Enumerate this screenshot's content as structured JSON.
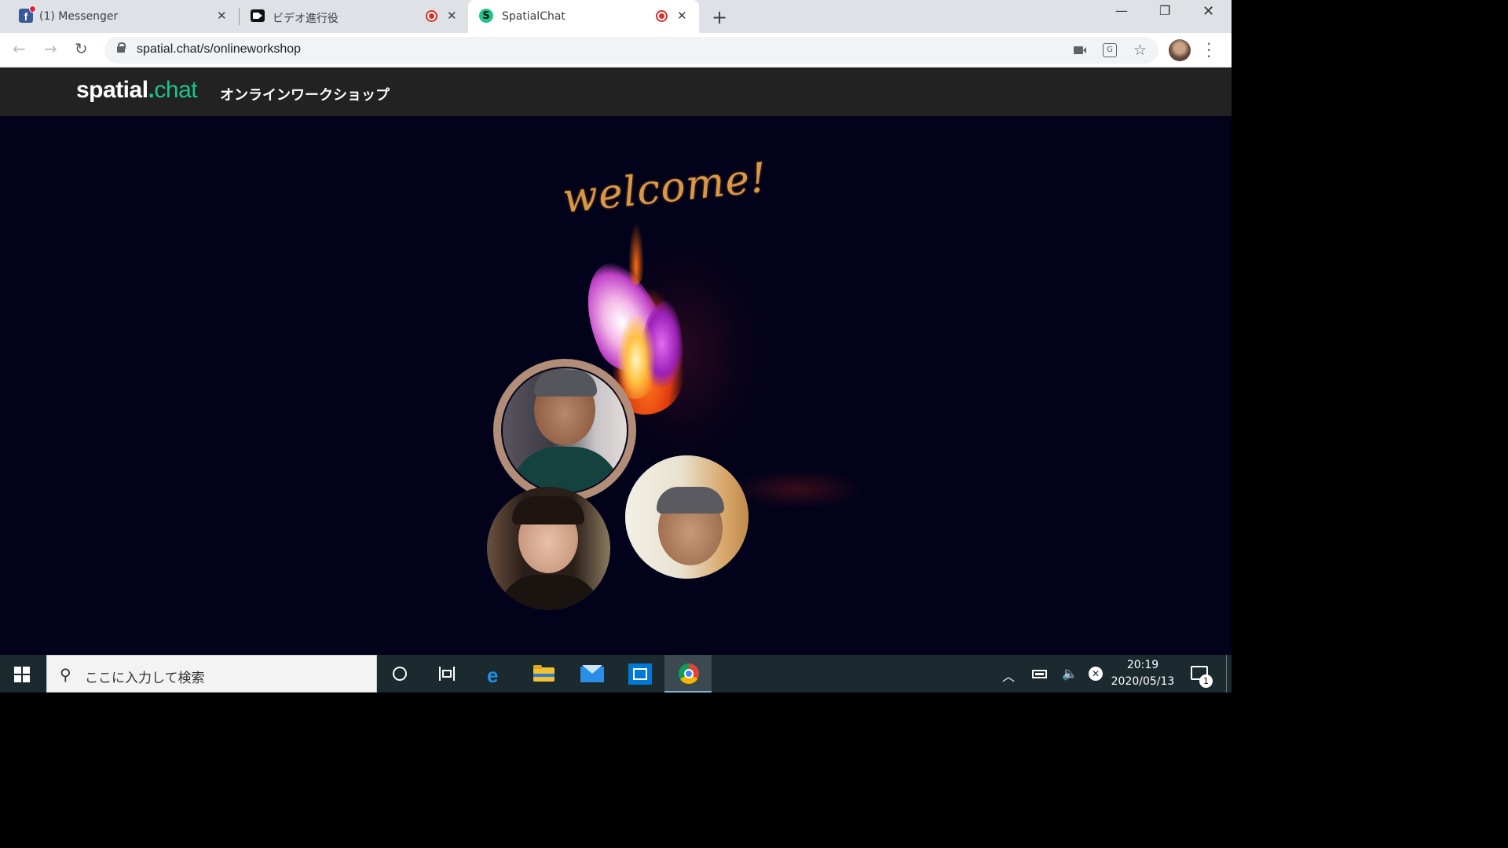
{
  "browser": {
    "tabs": [
      {
        "title": "(1) Messenger",
        "favicon": "facebook-icon"
      },
      {
        "title": "ビデオ進行役",
        "favicon": "video-camera-icon",
        "recording": true
      },
      {
        "title": "SpatialChat",
        "favicon": "spatialchat-icon",
        "recording": true,
        "active": true
      }
    ],
    "close_glyph": "✕",
    "newtab_glyph": "+",
    "url": "spatial.chat/s/onlineworkshop"
  },
  "app": {
    "logo_main": "spatial",
    "logo_dot": ".",
    "logo_chat": "chat",
    "room_name": "オンラインワークショップ",
    "welcome_text": "welcome!",
    "accent_color": "#1ec58b",
    "background_color": "#02021a",
    "participants": [
      {
        "name": "participant-1",
        "speaking": true
      },
      {
        "name": "participant-2"
      },
      {
        "name": "participant-3"
      }
    ]
  },
  "taskbar": {
    "search_placeholder": "ここに入力して検索",
    "time": "20:19",
    "date": "2020/05/13",
    "notification_count": "1",
    "apps": [
      "cortana-icon",
      "task-view-icon",
      "edge-icon",
      "file-explorer-icon",
      "mail-icon",
      "store-icon",
      "chrome-icon"
    ]
  }
}
